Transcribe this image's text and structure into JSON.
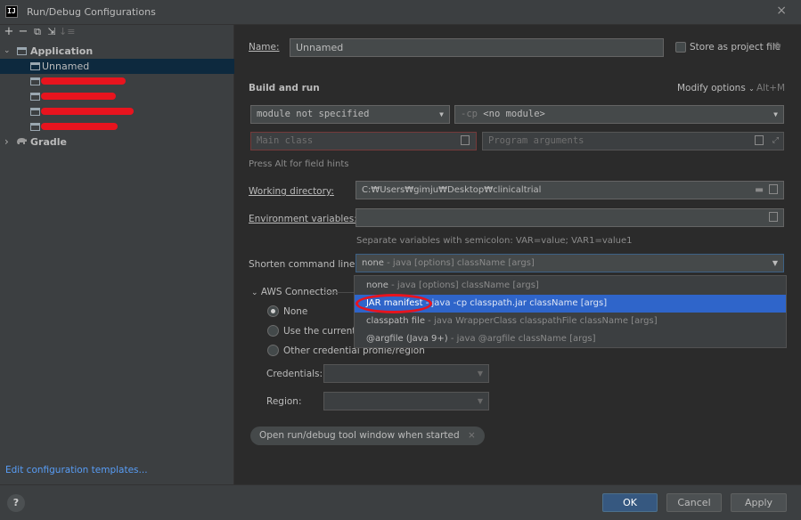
{
  "window": {
    "logo": "IJ",
    "title": "Run/Debug Configurations",
    "close_icon": "×"
  },
  "toolbar": {
    "add": "+",
    "remove": "−",
    "copy": "⧉",
    "move": "⇲",
    "sort": "↓≡"
  },
  "tree": {
    "application_label": "Application",
    "unnamed_label": "Unnamed",
    "gradle_label": "Gradle",
    "expanded_chevron": "⌄",
    "collapsed_chevron": "›"
  },
  "edit_templates": "Edit configuration templates...",
  "form": {
    "name_label": "Name:",
    "name_value": "Unnamed",
    "store_label": "Store as project file",
    "build_run_title": "Build and run",
    "modify_options": "Modify options",
    "modify_shortcut": "Alt+M",
    "module_value": "module not specified",
    "cp_prefix": "-cp",
    "cp_value": "<no module>",
    "main_class_placeholder": "Main class",
    "program_args_placeholder": "Program arguments",
    "alt_hint": "Press Alt for field hints",
    "working_dir_label": "Working directory:",
    "working_dir_value": "C:₩Users₩gimju₩Desktop₩clinicaltrial",
    "env_label": "Environment variables:",
    "env_hint": "Separate variables with semicolon: VAR=value; VAR1=value1",
    "shorten_label": "Shorten command line:",
    "shorten_value": "none",
    "shorten_value_sub": "- java [options] className [args]"
  },
  "shorten_options": [
    {
      "main": "none",
      "sub": "- java [options] className [args]"
    },
    {
      "main": "JAR manifest",
      "sub": "- java -cp classpath.jar className [args]"
    },
    {
      "main": "classpath file",
      "sub": "- java WrapperClass classpathFile className [args]"
    },
    {
      "main": "@argfile (Java 9+)",
      "sub": "- java @argfile className [args]"
    }
  ],
  "aws": {
    "section_label": "AWS Connection",
    "none": "None",
    "use_current": "Use the currently",
    "other_profile": "Other credential profile/region",
    "credentials_label": "Credentials:",
    "region_label": "Region:"
  },
  "chip_label": "Open run/debug tool window when started",
  "chip_close": "×",
  "footer": {
    "help": "?",
    "ok": "OK",
    "cancel": "Cancel",
    "apply": "Apply"
  },
  "colors": {
    "accent": "#2f65ca",
    "link": "#589df6",
    "annotation": "#e8141e"
  }
}
